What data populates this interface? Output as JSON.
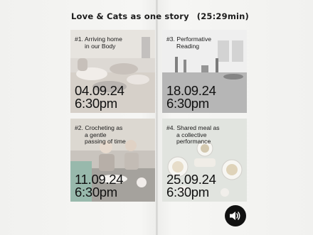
{
  "header": {
    "title": "Love & Cats as one story",
    "duration": "(25:29min)"
  },
  "tiles": [
    {
      "title_line1": "#1. Arriving home",
      "title_line2": "in our Body",
      "date": "04.09.24",
      "time": "6:30pm"
    },
    {
      "title_line1": "#3. Performative",
      "title_line2": "Reading",
      "date": "18.09.24",
      "time": "6:30pm"
    },
    {
      "title_line1": "#2. Crocheting as",
      "title_line2": "a gentle",
      "title_line3": "passing of time",
      "date": "11.09.24",
      "time": "6:30pm"
    },
    {
      "title_line1": "#4. Shared meal as",
      "title_line2": "a collective",
      "title_line3": "performance",
      "date": "25.09.24",
      "time": "6:30pm"
    }
  ],
  "controls": {
    "sound_icon": "speaker-icon"
  }
}
